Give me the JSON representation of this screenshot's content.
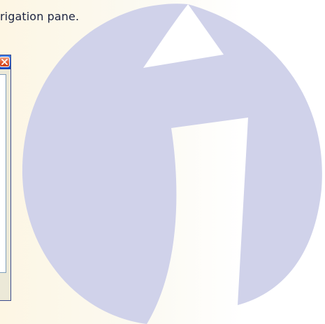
{
  "instruction": {
    "text": "rigation pane."
  },
  "window": {
    "close_icon": "close-icon",
    "titlebar_color": "#2a68e4",
    "close_color": "#e0562a",
    "body_color": "#ece9d8"
  },
  "watermark": {
    "icon": "watermark-logo",
    "color": "#d0d2ea"
  }
}
